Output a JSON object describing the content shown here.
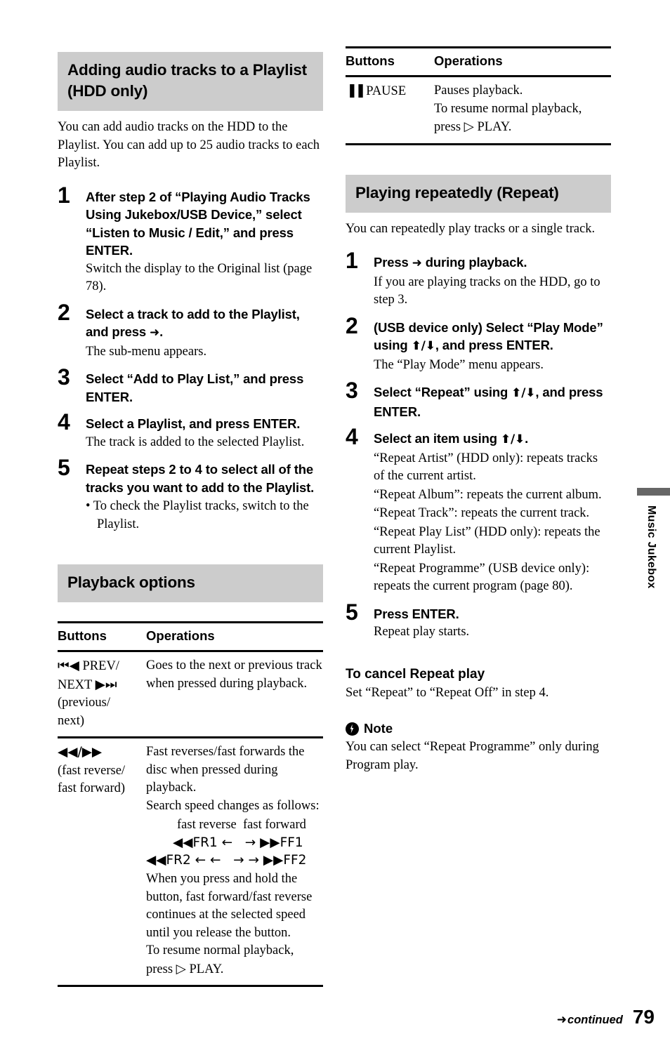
{
  "page": {
    "number": "79",
    "continued_label": "continued",
    "continued_arrow": "➜",
    "side_tab_label": "Music Jukebox",
    "accent_gray": "#cccccc",
    "tab_bar_gray": "#666666"
  },
  "left": {
    "heading": "Adding audio tracks to a Playlist (HDD only)",
    "intro": "You can add audio tracks on the HDD to the Playlist. You can add up to 25 audio tracks to each Playlist.",
    "steps": [
      {
        "num": "1",
        "head": "After step 2 of “Playing Audio Tracks Using Jukebox/USB Device,” select “Listen to Music / Edit,” and press ENTER.",
        "sub": "Switch the display to the Original list (page 78)."
      },
      {
        "num": "2",
        "head_pre": "Select a track to add to the Playlist, and press ",
        "head_arrow": "➜",
        "head_post": ".",
        "sub": "The sub-menu appears."
      },
      {
        "num": "3",
        "head": "Select “Add to Play List,” and press ENTER.",
        "sub": ""
      },
      {
        "num": "4",
        "head": "Select a Playlist, and press ENTER.",
        "sub": "The track is added to the selected Playlist."
      },
      {
        "num": "5",
        "head": "Repeat steps 2 to 4 to select all of the tracks you want to add to the Playlist.",
        "bullet": "• To check the Playlist tracks, switch to the Playlist."
      }
    ],
    "playback_heading": "Playback options",
    "table": {
      "columns": [
        "Buttons",
        "Operations"
      ],
      "rows": [
        {
          "button_sym": "⏮◀",
          "button_text_1": " PREV/",
          "button_text_2": "NEXT ",
          "button_sym_2": "▶⏭",
          "button_text_3": "(previous/",
          "button_text_4": "next)",
          "operation": "Goes to the next or previous track when pressed during playback."
        },
        {
          "button_sym": "◀◀/▶▶",
          "button_text_3": "(fast reverse/",
          "button_text_4": "fast forward)",
          "operation_1": "Fast reverses/fast forwards the disc when pressed during playback.",
          "operation_2": "Search speed changes as follows:",
          "speed_diagram": {
            "label_reverse": "fast reverse",
            "label_forward": "fast forward",
            "row1": "◀◀FR1 ←   → ▶▶FF1",
            "row2": "◀◀FR2 ← ←   → → ▶▶FF2"
          },
          "operation_3": "When you press and hold the button, fast forward/fast reverse continues at the selected speed until you release the button.",
          "operation_4_pre": "To resume normal playback, press ",
          "operation_4_sym": "▷",
          "operation_4_post": " PLAY."
        }
      ]
    }
  },
  "right": {
    "table": {
      "columns": [
        "Buttons",
        "Operations"
      ],
      "rows": [
        {
          "button_sym": "▐▐",
          "button_text": " PAUSE",
          "operation_1": "Pauses playback.",
          "operation_2_pre": "To resume normal playback, press ",
          "operation_2_sym": "▷",
          "operation_2_post": " PLAY."
        }
      ]
    },
    "heading": "Playing repeatedly (Repeat)",
    "intro": "You can repeatedly play tracks or a single track.",
    "steps": [
      {
        "num": "1",
        "head_pre": "Press ",
        "head_arrow": "➜",
        "head_post": " during playback.",
        "sub": "If you are playing tracks on the HDD, go to step 3."
      },
      {
        "num": "2",
        "head_pre": "(USB device only) Select “Play Mode” using ",
        "head_arrow": "⬆/⬇",
        "head_post": ", and press ENTER.",
        "sub": "The “Play Mode” menu appears."
      },
      {
        "num": "3",
        "head_pre": "Select “Repeat” using ",
        "head_arrow": "⬆/⬇",
        "head_post": ", and press ENTER.",
        "sub": ""
      },
      {
        "num": "4",
        "head_pre": "Select an item using ",
        "head_arrow": "⬆/⬇",
        "head_post": ".",
        "sub_lines": [
          "“Repeat Artist” (HDD only): repeats tracks of the current artist.",
          "“Repeat Album”: repeats the current album.",
          "“Repeat Track”: repeats the current track.",
          "“Repeat Play List” (HDD only): repeats the current Playlist.",
          "“Repeat Programme” (USB device only): repeats the current program (page 80)."
        ]
      },
      {
        "num": "5",
        "head": "Press ENTER.",
        "sub": "Repeat play starts."
      }
    ],
    "cancel_heading": "To cancel Repeat play",
    "cancel_body": "Set “Repeat” to “Repeat Off” in step 4.",
    "note_label": "Note",
    "note_body": "You can select “Repeat Programme” only during Program play."
  }
}
